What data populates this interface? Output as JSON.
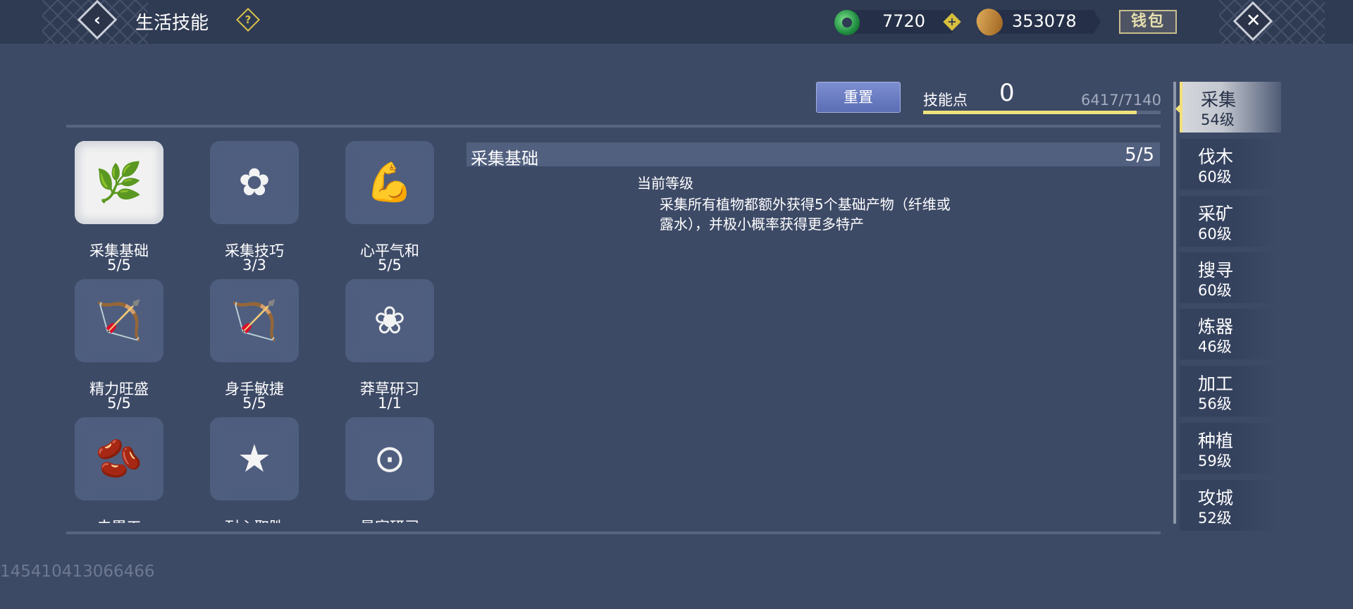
{
  "header": {
    "title": "生活技能",
    "help_symbol": "?",
    "back_symbol": "‹",
    "close_symbol": "✕",
    "currency1_value": "7720",
    "currency1_icon": "jade-icon",
    "currency2_value": "353078",
    "currency2_icon": "coin-icon",
    "plus_symbol": "+",
    "wallet_label": "钱包"
  },
  "skill_points": {
    "reset_label": "重置",
    "label": "技能点",
    "value": "0",
    "progress_text": "6417/7140",
    "progress_fraction": 0.8987
  },
  "skills": [
    {
      "name": "采集基础",
      "level": "5/5",
      "icon": "herb-sprig-icon",
      "glyph": "🌿",
      "selected": true
    },
    {
      "name": "采集技巧",
      "level": "3/3",
      "icon": "flower-icon",
      "glyph": "✿",
      "selected": false
    },
    {
      "name": "心平气和",
      "level": "5/5",
      "icon": "flexed-arm-icon",
      "glyph": "💪",
      "selected": false
    },
    {
      "name": "精力旺盛",
      "level": "5/5",
      "icon": "bow-arrow-icon",
      "glyph": "🏹",
      "selected": false
    },
    {
      "name": "身手敏捷",
      "level": "5/5",
      "icon": "bow-arrow-icon",
      "glyph": "🏹",
      "selected": false
    },
    {
      "name": "莽草研习",
      "level": "1/1",
      "icon": "lily-icon",
      "glyph": "❀",
      "selected": false
    },
    {
      "name": "去胃工",
      "level": "",
      "icon": "stomach-icon",
      "glyph": "🫘",
      "selected": false
    },
    {
      "name": "耐心取胜",
      "level": "",
      "icon": "star-banner-icon",
      "glyph": "★",
      "selected": false
    },
    {
      "name": "星宿研习",
      "level": "",
      "icon": "constellation-icon",
      "glyph": "⊙",
      "selected": false
    }
  ],
  "detail": {
    "title": "采集基础",
    "level": "5/5",
    "current_label": "当前等级",
    "description": "采集所有植物都额外获得5个基础产物（纤维或露水），并极小概率获得更多特产"
  },
  "categories": [
    {
      "name": "采集",
      "level": "54级",
      "active": true
    },
    {
      "name": "伐木",
      "level": "60级",
      "active": false
    },
    {
      "name": "采矿",
      "level": "60级",
      "active": false
    },
    {
      "name": "搜寻",
      "level": "60级",
      "active": false
    },
    {
      "name": "炼器",
      "level": "46级",
      "active": false
    },
    {
      "name": "加工",
      "level": "56级",
      "active": false
    },
    {
      "name": "种植",
      "level": "59级",
      "active": false
    },
    {
      "name": "攻城",
      "level": "52级",
      "active": false
    }
  ],
  "uid": "145410413066466",
  "colors": {
    "background": "#3d4a66",
    "accent_gold": "#f1df7a",
    "reset_button": "#6b7cc3"
  }
}
